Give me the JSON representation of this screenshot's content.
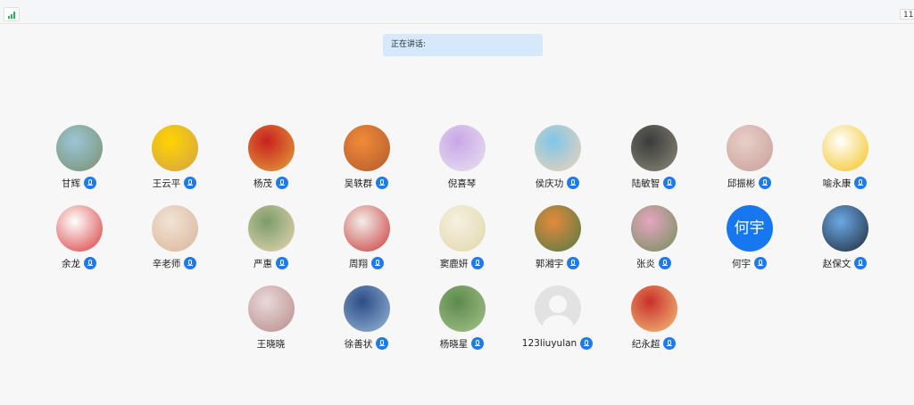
{
  "topbar": {
    "count": "11"
  },
  "speaking": {
    "label": "正在讲话:"
  },
  "participants": [
    {
      "name": "甘辉",
      "mic": true,
      "avatar": "photo",
      "colors": [
        "#9cc6d8",
        "#7a8f6b"
      ]
    },
    {
      "name": "王云平",
      "mic": true,
      "avatar": "photo",
      "colors": [
        "#ffd400",
        "#d4a24a"
      ]
    },
    {
      "name": "杨茂",
      "mic": true,
      "avatar": "photo",
      "colors": [
        "#c9201f",
        "#e3a43a"
      ]
    },
    {
      "name": "吴轶群",
      "mic": true,
      "avatar": "photo",
      "colors": [
        "#f28a3a",
        "#b05b2c"
      ]
    },
    {
      "name": "倪喜琴",
      "mic": false,
      "avatar": "photo",
      "colors": [
        "#c9a7e8",
        "#e9e3f0"
      ]
    },
    {
      "name": "侯庆功",
      "mic": true,
      "avatar": "photo",
      "colors": [
        "#7fc6e8",
        "#f1d3b8"
      ]
    },
    {
      "name": "陆敏智",
      "mic": true,
      "avatar": "photo",
      "colors": [
        "#3b3b3b",
        "#8a8a7a"
      ]
    },
    {
      "name": "邱振彬",
      "mic": true,
      "avatar": "photo",
      "colors": [
        "#e9cfc9",
        "#c89f98"
      ]
    },
    {
      "name": "喻永康",
      "mic": true,
      "avatar": "photo",
      "colors": [
        "#ffffff",
        "#f2c21a"
      ]
    },
    {
      "name": "余龙",
      "mic": true,
      "avatar": "photo",
      "colors": [
        "#ffffff",
        "#d83a3a"
      ]
    },
    {
      "name": "辛老师",
      "mic": true,
      "avatar": "photo",
      "colors": [
        "#f1e3d4",
        "#d9b59a"
      ]
    },
    {
      "name": "严惠",
      "mic": true,
      "avatar": "photo",
      "colors": [
        "#7c9c6a",
        "#e8d6b4"
      ]
    },
    {
      "name": "周翔",
      "mic": true,
      "avatar": "photo",
      "colors": [
        "#f3eee8",
        "#c93a3a"
      ]
    },
    {
      "name": "窦鹿妍",
      "mic": true,
      "avatar": "photo",
      "colors": [
        "#f6f1e2",
        "#e0d6a8"
      ]
    },
    {
      "name": "郭湘宇",
      "mic": true,
      "avatar": "photo",
      "colors": [
        "#e58a3a",
        "#4f7a4a"
      ]
    },
    {
      "name": "张炎",
      "mic": true,
      "avatar": "photo",
      "colors": [
        "#e6a6c0",
        "#6f8f5a"
      ]
    },
    {
      "name": "何宇",
      "mic": true,
      "avatar": "text",
      "avatar_text": "何宇",
      "colors": [
        "#1677ef",
        "#1677ef"
      ]
    },
    {
      "name": "赵保文",
      "mic": true,
      "avatar": "photo",
      "colors": [
        "#6ba9e6",
        "#1f2b38"
      ]
    },
    {
      "name": "王晓晓",
      "mic": false,
      "avatar": "photo",
      "colors": [
        "#e9d9d9",
        "#b98a8a"
      ]
    },
    {
      "name": "徐善状",
      "mic": true,
      "avatar": "photo",
      "colors": [
        "#2a4d86",
        "#9ab8d8"
      ]
    },
    {
      "name": "杨晓星",
      "mic": true,
      "avatar": "photo",
      "colors": [
        "#5c8a4d",
        "#a7c28a"
      ]
    },
    {
      "name": "123liuyulan",
      "mic": true,
      "avatar": "default",
      "colors": [
        "#e2e2e2",
        "#f7f7f7"
      ]
    },
    {
      "name": "纪永超",
      "mic": true,
      "avatar": "photo",
      "colors": [
        "#c9302c",
        "#f3c27a"
      ]
    }
  ]
}
